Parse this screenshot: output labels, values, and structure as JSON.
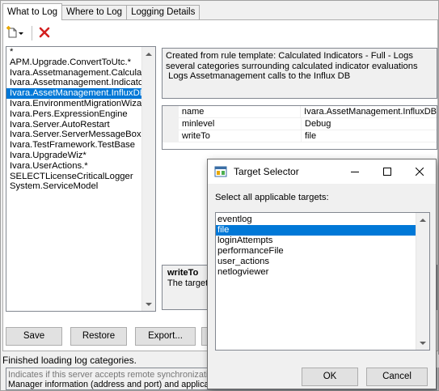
{
  "tabs": [
    {
      "label": "What to Log",
      "active": true
    },
    {
      "label": "Where to Log",
      "active": false
    },
    {
      "label": "Logging Details",
      "active": false
    }
  ],
  "toolbar": {
    "new_icon": "new-document-icon",
    "delete_icon": "delete-x-icon"
  },
  "categories": {
    "items": [
      "*",
      "APM.Upgrade.ConvertToUtc.*",
      "Ivara.Assetmanagement.Calculated",
      "Ivara.Assetmanagement.Indicators",
      "Ivara.AssetManagement.InfluxDB",
      "Ivara.EnvironmentMigrationWizard",
      "Ivara.Pers.ExpressionEngine",
      "Ivara.Server.AutoRestart",
      "Ivara.Server.ServerMessageBoxCa",
      "Ivara.TestFramework.TestBase",
      "Ivara.UpgradeWiz*",
      "Ivara.UserActions.*",
      "SELECTLicenseCriticalLogger",
      "System.ServiceModel"
    ],
    "selected_index": 4
  },
  "description": {
    "line1": "Created from rule template: Calculated Indicators - Full - Logs several categories surrounding calculated indicator evaluations",
    "line2": " Logs Assetmanagement calls to the Influx DB"
  },
  "properties": [
    {
      "name": "name",
      "value": "Ivara.AssetManagement.InfluxDB"
    },
    {
      "name": "minlevel",
      "value": "Debug"
    },
    {
      "name": "writeTo",
      "value": "file"
    }
  ],
  "help": {
    "title": "writeTo",
    "description": "The target"
  },
  "buttons": {
    "save": "Save",
    "restore": "Restore",
    "export": "Export..."
  },
  "status": {
    "text": "Finished loading log categories."
  },
  "info": {
    "line1": "Indicates if this server accepts remote synchronization",
    "line2": "Manager information (address and port) and applicatio"
  },
  "dialog": {
    "title": "Target Selector",
    "prompt": "Select all applicable targets:",
    "targets": [
      "eventlog",
      "file",
      "loginAttempts",
      "performanceFile",
      "user_actions",
      "netlogviewer"
    ],
    "selected_index": 1,
    "ok_label": "OK",
    "cancel_label": "Cancel"
  },
  "colors": {
    "selection": "#0078d7",
    "delete_icon": "#d32020"
  }
}
